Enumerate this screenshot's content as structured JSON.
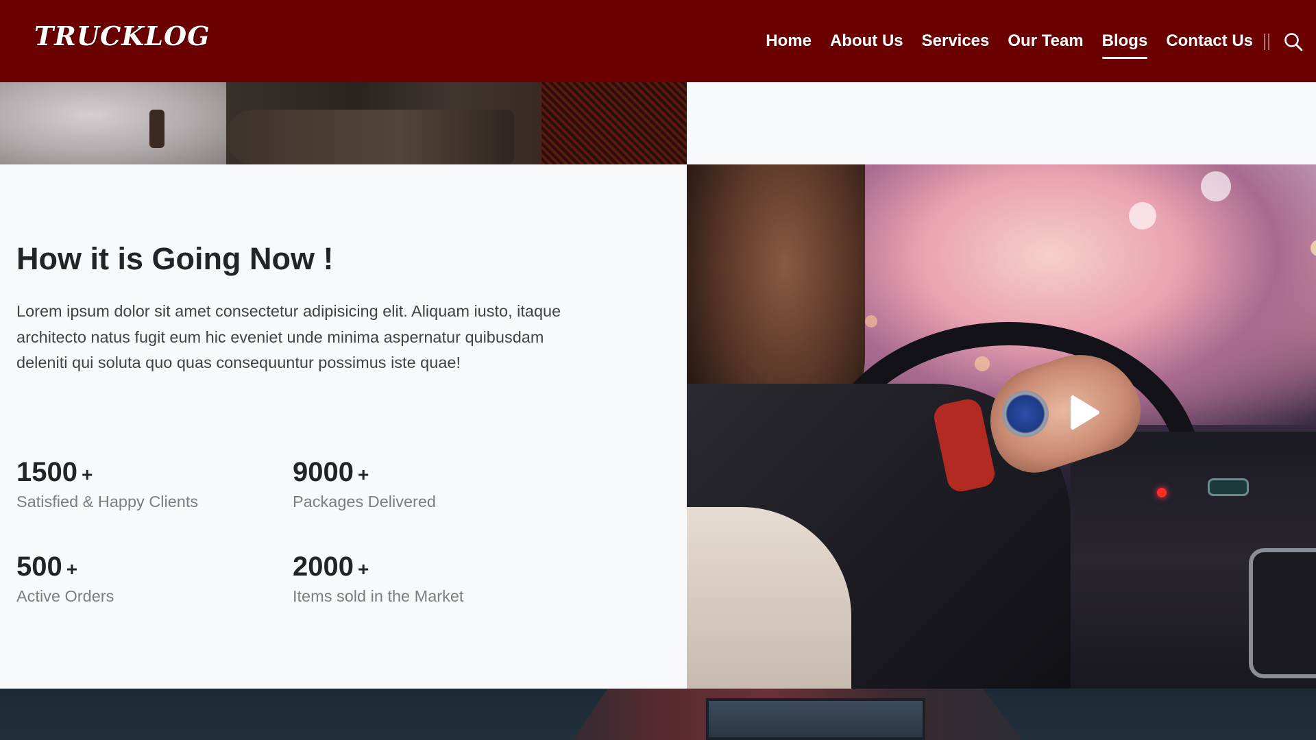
{
  "header": {
    "logo": "TRUCKLOG",
    "nav": [
      {
        "label": "Home",
        "active": false
      },
      {
        "label": "About Us",
        "active": false
      },
      {
        "label": "Services",
        "active": false
      },
      {
        "label": "Our Team",
        "active": false
      },
      {
        "label": "Blogs",
        "active": true
      },
      {
        "label": "Contact Us",
        "active": false
      }
    ],
    "search_icon": "search-icon",
    "background_color": "#6b0000"
  },
  "main": {
    "title": "How it is Going Now !",
    "description": "Lorem ipsum dolor sit amet consectetur adipisicing elit. Aliquam iusto, itaque architecto natus fugit eum hic eveniet unde minima aspernatur quibusdam deleniti qui soluta quo quas consequuntur possimus iste quae!",
    "stats": [
      {
        "number": "1500",
        "suffix": "+",
        "label": "Satisfied & Happy Clients"
      },
      {
        "number": "9000",
        "suffix": "+",
        "label": "Packages Delivered"
      },
      {
        "number": "500",
        "suffix": "+",
        "label": "Active Orders"
      },
      {
        "number": "2000",
        "suffix": "+",
        "label": "Items sold in the Market"
      }
    ]
  },
  "video": {
    "play_icon": "play-icon"
  }
}
